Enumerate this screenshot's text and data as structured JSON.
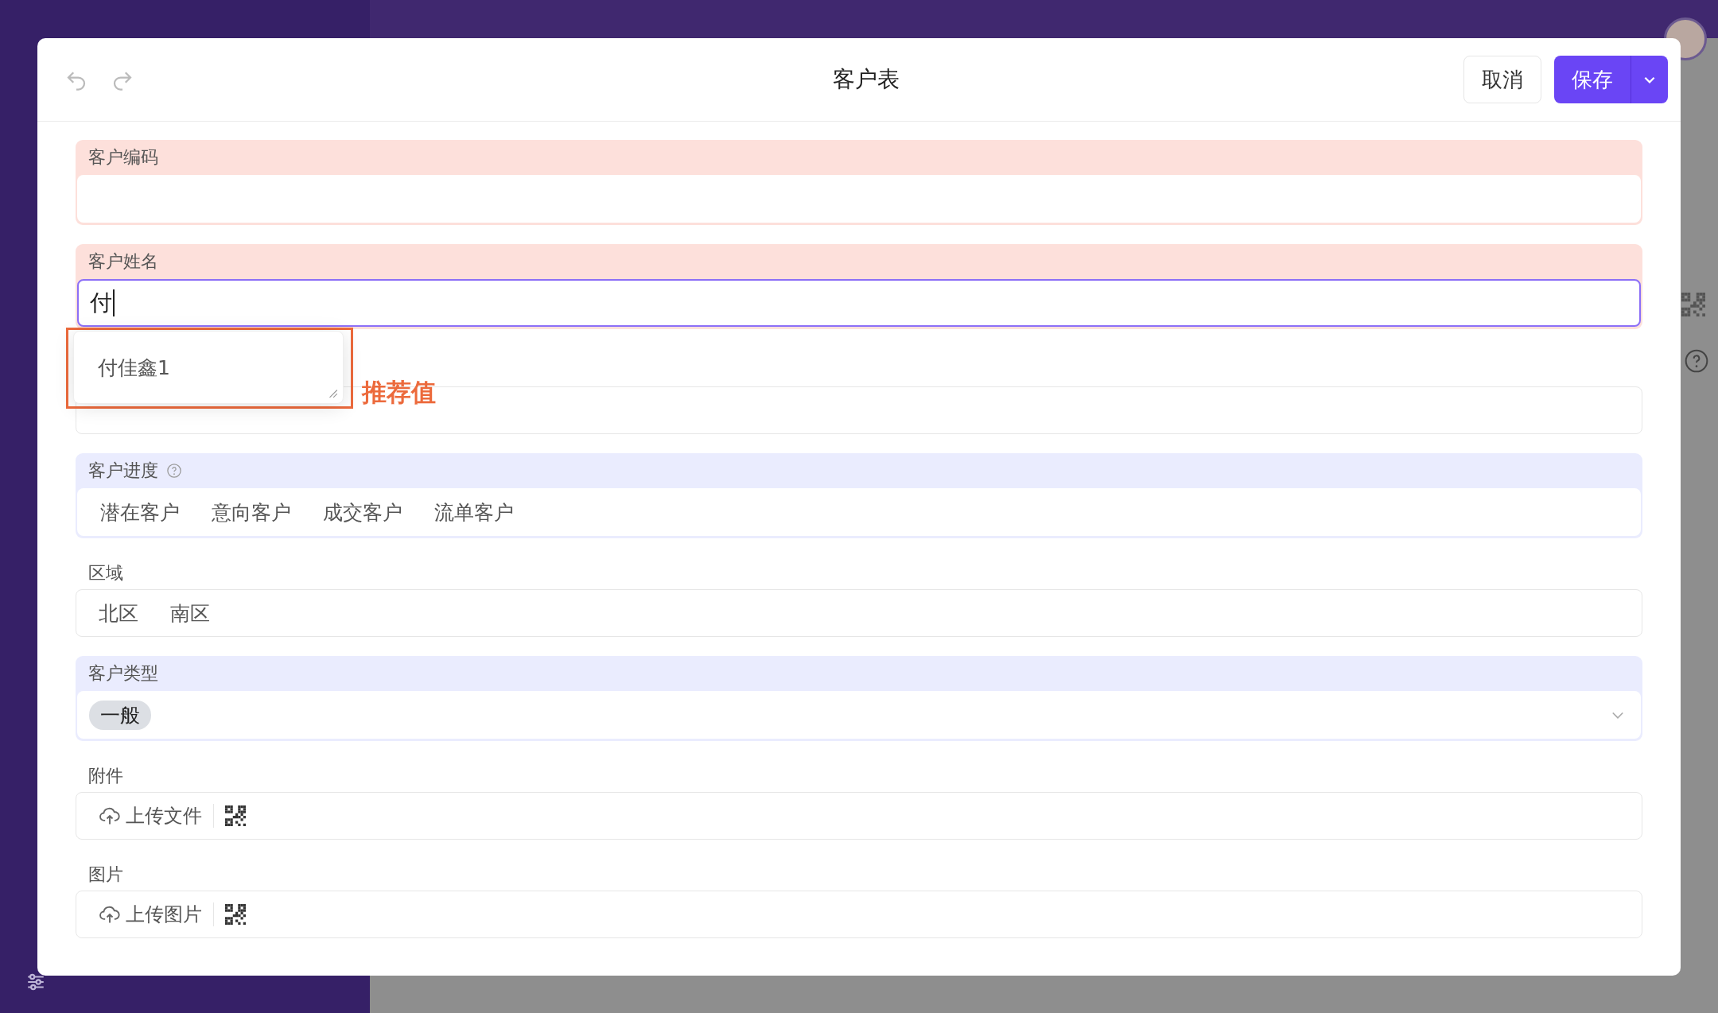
{
  "window": {
    "title": "客户表"
  },
  "toolbar": {
    "cancel": "取消",
    "save": "保存"
  },
  "fields": [
    {
      "kind": "text",
      "label": "客户编码",
      "color": "#fde0db",
      "focused": false
    },
    {
      "kind": "text",
      "label": "客户姓名",
      "color": "#fde0db",
      "value": "付",
      "focused": true
    },
    {
      "kind": "text",
      "focused": false
    },
    {
      "kind": "choice",
      "label": "客户进度",
      "color": "#eaecfe",
      "help": true,
      "options": [
        {
          "label": "潜在客户",
          "selected": false
        },
        {
          "label": "意向客户",
          "selected": false
        },
        {
          "label": "成交客户",
          "selected": false
        },
        {
          "label": "流单客户",
          "selected": false
        }
      ]
    },
    {
      "kind": "choice",
      "label": "区域",
      "options": [
        {
          "label": "北区",
          "selected": false
        },
        {
          "label": "南区",
          "selected": false
        }
      ]
    },
    {
      "kind": "select",
      "label": "客户类型",
      "color": "#eaecfe",
      "tags": [
        "一般"
      ]
    },
    {
      "kind": "upload",
      "label": "附件",
      "action": "上传文件"
    },
    {
      "kind": "upload",
      "label": "图片",
      "action": "上传图片"
    }
  ],
  "suggestions": {
    "items": [
      "付佳鑫1"
    ],
    "annotation": "推荐值"
  }
}
